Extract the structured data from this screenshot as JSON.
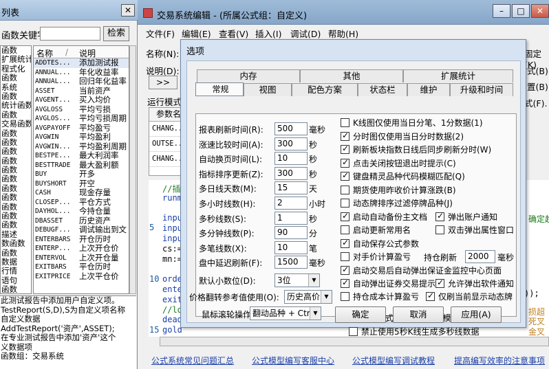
{
  "left_panel": {
    "title": "列表",
    "search_label": "函数关键字",
    "search_button": "检索",
    "categories": [
      "函数",
      "扩展统计",
      "程式化",
      "函数",
      "系统",
      "函数",
      "统计函数",
      "函数",
      "交易函数",
      "函数",
      "函数",
      "函数",
      "函数",
      "函数",
      "函数",
      "函数",
      "函数",
      "函数",
      "函数",
      "函数",
      "描述",
      "数函数",
      "函数",
      "数据",
      "行情",
      "语句",
      "函数",
      "基础信息",
      "函数",
      "函数数据统计"
    ],
    "col_name": "名称",
    "col_desc": "说明",
    "rows": [
      {
        "n": "ADDTES...",
        "d": "添加测试报"
      },
      {
        "n": "ANNUAL...",
        "d": "年化收益率"
      },
      {
        "n": "ANNUAL...",
        "d": "回归年化益率"
      },
      {
        "n": "ASSET",
        "d": "当前资产"
      },
      {
        "n": "AVGENT...",
        "d": "买入均价"
      },
      {
        "n": "AVGLOSS",
        "d": "平均亏损"
      },
      {
        "n": "AVGLOS...",
        "d": "平均亏损周期"
      },
      {
        "n": "AVGPAYOFF",
        "d": "平均盈亏"
      },
      {
        "n": "AVGWIN",
        "d": "平均盈利"
      },
      {
        "n": "AVGWIN...",
        "d": "平均盈利周期"
      },
      {
        "n": "BESTPE...",
        "d": "最大利润率"
      },
      {
        "n": "BESTTRADE",
        "d": "最大盈利额"
      },
      {
        "n": "BUY",
        "d": "开多"
      },
      {
        "n": "BUYSHORT",
        "d": "开空"
      },
      {
        "n": "CASH",
        "d": "现金存量"
      },
      {
        "n": "CLOSEP...",
        "d": "平仓方式"
      },
      {
        "n": "DAYHOL...",
        "d": "今持仓量"
      },
      {
        "n": "DBASSET",
        "d": "历史资产"
      },
      {
        "n": "DEBUGF...",
        "d": "调试输出到文"
      },
      {
        "n": "ENTERBARS",
        "d": "开仓历时"
      },
      {
        "n": "ENTERP...",
        "d": "上次开仓价"
      },
      {
        "n": "ENTERVOL",
        "d": "上次开仓量"
      },
      {
        "n": "EXITBARS",
        "d": "平仓历时"
      },
      {
        "n": "EXITPRICE",
        "d": "上次平仓价"
      }
    ],
    "description": [
      "此测试报告中添加用户自定义项。",
      "",
      "TestReport(S,D),S为自定义项名称",
      "自定义数据",
      "AddTestReport('资产',ASSET);",
      "在专业测试报告中添加'资产'这个",
      "义数据项",
      "函数组：交易系统"
    ]
  },
  "main_window": {
    "title": "交易系统编辑 - (所属公式组：自定义)",
    "menu": [
      "文件(F)",
      "编辑(E)",
      "查看(V)",
      "插入(I)",
      "调试(D)",
      "帮助(H)"
    ],
    "labels": {
      "name": "名称(N):",
      "desc": "说明(D):",
      "run_mode": "运行模式",
      "param_name": "参数名",
      "fixed": "固定(K)",
      "right1": "式(B)",
      "right2": "置(B)",
      "right3": "式(F)."
    },
    "params": [
      "CHANG...",
      "OUTSE...",
      "CHANG..."
    ],
    "code_lines": [
      "//插",
      "runm",
      "",
      "inpu",
      "inpu",
      "inpu",
      "cs:=",
      "mn:=",
      "",
      "orde",
      "ente",
      "exit",
      "//lo",
      "dead",
      "gold"
    ],
    "code_right": [
      "确定趋",
      "));",
      "损超",
      "死叉",
      "金叉"
    ],
    "line_numbers": [
      "5",
      "10",
      "15"
    ],
    "links": [
      "公式系统常见问题汇总",
      "公式模型编写客服中心",
      "公式模型编写调试教程",
      "提高编写效率的注意事项"
    ]
  },
  "dialog": {
    "title": "选项",
    "tabs_row1": [
      "内存",
      "其他",
      "扩展统计"
    ],
    "tabs_row2": [
      "常规",
      "视图",
      "配色方案",
      "状态栏",
      "维护",
      "升级和时间"
    ],
    "selected_tab": "常规",
    "fields": [
      {
        "label": "报表刷新时间(R):",
        "value": "500",
        "unit": "毫秒"
      },
      {
        "label": "涨速比较时间(A):",
        "value": "300",
        "unit": "秒"
      },
      {
        "label": "自动换页时间(L):",
        "value": "10",
        "unit": "秒"
      },
      {
        "label": "指标排序更新(Z):",
        "value": "300",
        "unit": "秒"
      },
      {
        "label": "多日线天数(M):",
        "value": "15",
        "unit": "天"
      },
      {
        "label": "多小时线数(H):",
        "value": "2",
        "unit": "小时"
      },
      {
        "label": "多秒线数(S):",
        "value": "1",
        "unit": "秒"
      },
      {
        "label": "多分钟线数(P):",
        "value": "90",
        "unit": "分"
      },
      {
        "label": "多笔线数(X):",
        "value": "10",
        "unit": "笔"
      },
      {
        "label": "盘中延迟刷新(F):",
        "value": "1500",
        "unit": "毫秒"
      }
    ],
    "decimal_label": "默认小数位(D):",
    "decimal_value": "3位",
    "price_label": "价格翻转参考值使用(O):",
    "price_value": "历史高价",
    "scroll_label": "鼠标滚轮操作",
    "scroll_value": "翻动品种 + Ctr",
    "checks": [
      {
        "label": "K线图仅使用当日分笔、1分数据(1)",
        "on": false
      },
      {
        "label": "分时图仅使用当日分时数据(2)",
        "on": true
      },
      {
        "label": "刷新板块指数日线后同步刷新分时(W)",
        "on": true
      },
      {
        "label": "点击关闭按钮退出时提示(C)",
        "on": true
      },
      {
        "label": "键盘精灵品种代码模糊匹配(Q)",
        "on": true
      },
      {
        "label": "期货使用昨收价计算涨跌(B)",
        "on": false
      },
      {
        "label": "动态牌排序过滤停牌品种(J)",
        "on": false
      },
      {
        "label": "启动自动备份主文档",
        "on": true
      },
      {
        "label": "弹出账户通知",
        "on": true
      },
      {
        "label": "启动更新常用名",
        "on": false
      },
      {
        "label": "双击弹出属性窗口",
        "on": false
      },
      {
        "label": "自动保存公式参数",
        "on": true
      },
      {
        "label": "持仓刷新",
        "on": false
      },
      {
        "label": "对手价计算盈亏",
        "on": false
      },
      {
        "label": "启动交易后自动弹出保证金监控中心页面",
        "on": true
      },
      {
        "label": "自动弹出证券交易提示",
        "on": true
      },
      {
        "label": "允许弹出软件通知",
        "on": true
      },
      {
        "label": "持仓成本计算盈亏",
        "on": false
      },
      {
        "label": "仅刷当前显示动态牌",
        "on": true
      },
      {
        "label": "DLL公式加载驻留内存模式",
        "on": false
      },
      {
        "label": "禁止使用5秒K线生成多秒线数据",
        "on": false
      }
    ],
    "refresh_value": "2000",
    "refresh_unit": "毫秒",
    "buttons": [
      "确定",
      "取消",
      "应用(A)"
    ]
  }
}
